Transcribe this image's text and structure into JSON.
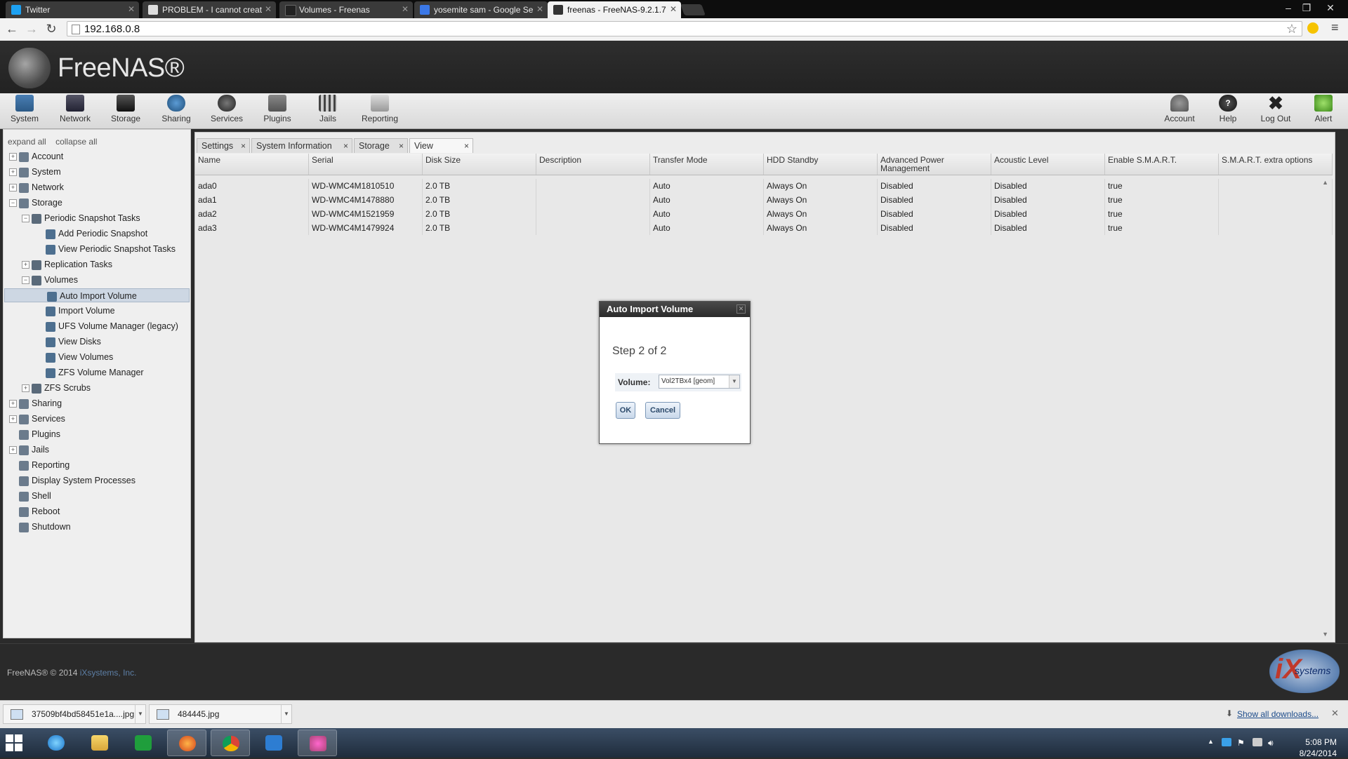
{
  "browser": {
    "tabs": [
      {
        "label": "Twitter",
        "icon": "twitter-icon",
        "active": false
      },
      {
        "label": "PROBLEM - I cannot creat",
        "icon": "freenas-icon",
        "active": false
      },
      {
        "label": "Volumes - Freenas",
        "icon": "freenas-icon",
        "active": false
      },
      {
        "label": "yosemite sam - Google Se",
        "icon": "google-icon",
        "active": false
      },
      {
        "label": "freenas - FreeNAS-9.2.1.7",
        "icon": "freenas-icon",
        "active": true
      }
    ],
    "url": "192.168.0.8"
  },
  "app": {
    "logo": "FreeNAS®",
    "toolbar_left": [
      "System",
      "Network",
      "Storage",
      "Sharing",
      "Services",
      "Plugins",
      "Jails",
      "Reporting"
    ],
    "toolbar_right": [
      "Account",
      "Help",
      "Log Out",
      "Alert"
    ]
  },
  "sidebar": {
    "expand_all": "expand all",
    "collapse_all": "collapse all",
    "items": [
      {
        "label": "Account",
        "level": 0,
        "toggle": "+"
      },
      {
        "label": "System",
        "level": 0,
        "toggle": "+"
      },
      {
        "label": "Network",
        "level": 0,
        "toggle": "+"
      },
      {
        "label": "Storage",
        "level": 0,
        "toggle": "−"
      },
      {
        "label": "Periodic Snapshot Tasks",
        "level": 1,
        "toggle": "−"
      },
      {
        "label": "Add Periodic Snapshot",
        "level": 2,
        "toggle": ""
      },
      {
        "label": "View Periodic Snapshot Tasks",
        "level": 2,
        "toggle": ""
      },
      {
        "label": "Replication Tasks",
        "level": 1,
        "toggle": "+"
      },
      {
        "label": "Volumes",
        "level": 1,
        "toggle": "−"
      },
      {
        "label": "Auto Import Volume",
        "level": 2,
        "toggle": "",
        "selected": true
      },
      {
        "label": "Import Volume",
        "level": 2,
        "toggle": ""
      },
      {
        "label": "UFS Volume Manager (legacy)",
        "level": 2,
        "toggle": ""
      },
      {
        "label": "View Disks",
        "level": 2,
        "toggle": ""
      },
      {
        "label": "View Volumes",
        "level": 2,
        "toggle": ""
      },
      {
        "label": "ZFS Volume Manager",
        "level": 2,
        "toggle": ""
      },
      {
        "label": "ZFS Scrubs",
        "level": 1,
        "toggle": "+"
      },
      {
        "label": "Sharing",
        "level": 0,
        "toggle": "+"
      },
      {
        "label": "Services",
        "level": 0,
        "toggle": "+"
      },
      {
        "label": "Plugins",
        "level": 0,
        "toggle": ""
      },
      {
        "label": "Jails",
        "level": 0,
        "toggle": "+"
      },
      {
        "label": "Reporting",
        "level": 0,
        "toggle": ""
      },
      {
        "label": "Display System Processes",
        "level": 0,
        "toggle": ""
      },
      {
        "label": "Shell",
        "level": 0,
        "toggle": ""
      },
      {
        "label": "Reboot",
        "level": 0,
        "toggle": ""
      },
      {
        "label": "Shutdown",
        "level": 0,
        "toggle": ""
      }
    ]
  },
  "content_tabs": [
    {
      "label": "Settings",
      "close": "×",
      "active": false
    },
    {
      "label": "System Information",
      "close": "×",
      "active": false
    },
    {
      "label": "Storage",
      "close": "×",
      "active": false
    },
    {
      "label": "View Disks",
      "close": "×",
      "active": true
    }
  ],
  "disks": {
    "columns": [
      "Name",
      "Serial",
      "Disk Size",
      "Description",
      "Transfer Mode",
      "HDD Standby",
      "Advanced Power Management",
      "Acoustic Level",
      "Enable S.M.A.R.T.",
      "S.M.A.R.T. extra options"
    ],
    "rows": [
      [
        "ada0",
        "WD-WMC4M1810510",
        "2.0 TB",
        "",
        "Auto",
        "Always On",
        "Disabled",
        "Disabled",
        "true",
        ""
      ],
      [
        "ada1",
        "WD-WMC4M1478880",
        "2.0 TB",
        "",
        "Auto",
        "Always On",
        "Disabled",
        "Disabled",
        "true",
        ""
      ],
      [
        "ada2",
        "WD-WMC4M1521959",
        "2.0 TB",
        "",
        "Auto",
        "Always On",
        "Disabled",
        "Disabled",
        "true",
        ""
      ],
      [
        "ada3",
        "WD-WMC4M1479924",
        "2.0 TB",
        "",
        "Auto",
        "Always On",
        "Disabled",
        "Disabled",
        "true",
        ""
      ]
    ]
  },
  "dialog": {
    "title": "Auto Import Volume",
    "step": "Step 2 of 2",
    "volume_label": "Volume:",
    "volume_value": "Vol2TBx4 [geom]",
    "ok": "OK",
    "cancel": "Cancel"
  },
  "footer": {
    "copyright": "FreeNAS® © 2014",
    "company_link": "iXsystems, Inc.",
    "partner_logo": "systems"
  },
  "downloads": {
    "items": [
      "37509bf4bd58451e1a....jpg",
      "484445.jpg"
    ],
    "show_all": "Show all downloads..."
  },
  "taskbar": {
    "time": "5:08 PM",
    "date": "8/24/2014"
  },
  "colors": {
    "header_bg": "#2b2b2b",
    "dialog_title_bg": "#333333",
    "selected_row": "#cdd7e3",
    "link": "#5d7fa6"
  }
}
